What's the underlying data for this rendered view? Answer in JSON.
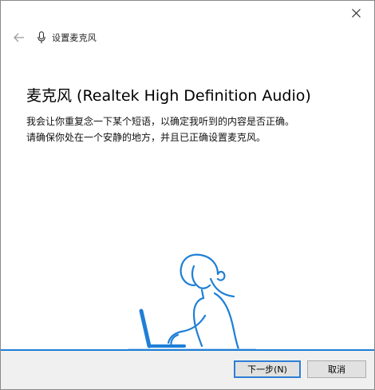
{
  "window": {
    "close_icon": "close-icon"
  },
  "nav": {
    "back_icon": "back-arrow-icon",
    "mic_icon": "microphone-icon",
    "title": "设置麦克风"
  },
  "content": {
    "headline": "麦克风 (Realtek High Definition Audio)",
    "instruction_line1": "我会让你重复念一下某个短语，以确定我听到的内容是否正确。",
    "instruction_line2": "请确保你处在一个安静的地方，并且已正确设置麦克风。"
  },
  "illustration": {
    "name": "person-with-laptop-illustration",
    "color": "#1e7fd6"
  },
  "footer": {
    "next_label": "下一步(N)",
    "cancel_label": "取消"
  },
  "colors": {
    "accent": "#1e7fd6",
    "footer_bg": "#f0f0f0"
  }
}
